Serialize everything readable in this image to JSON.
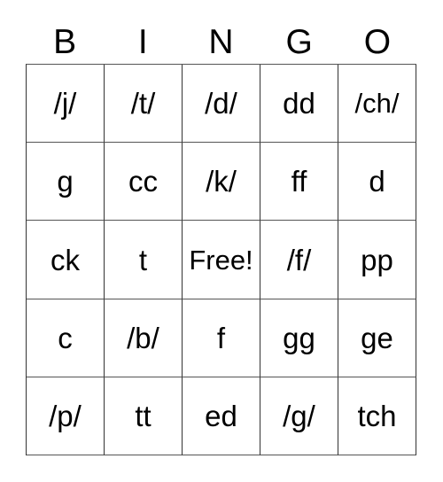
{
  "card": {
    "title": "BINGO",
    "header": [
      "B",
      "I",
      "N",
      "G",
      "O"
    ],
    "grid": [
      [
        "/j/",
        "/t/",
        "/d/",
        "dd",
        "/ch/"
      ],
      [
        "g",
        "cc",
        "/k/",
        "ff",
        "d"
      ],
      [
        "ck",
        "t",
        "Free!",
        "/f/",
        "pp"
      ],
      [
        "c",
        "/b/",
        "f",
        "gg",
        "ge"
      ],
      [
        "/p/",
        "tt",
        "ed",
        "/g/",
        "tch"
      ]
    ],
    "free_space": "Free!",
    "colors": {
      "background": "#ffffff",
      "text": "#000000",
      "grid_line": "#333333"
    }
  }
}
